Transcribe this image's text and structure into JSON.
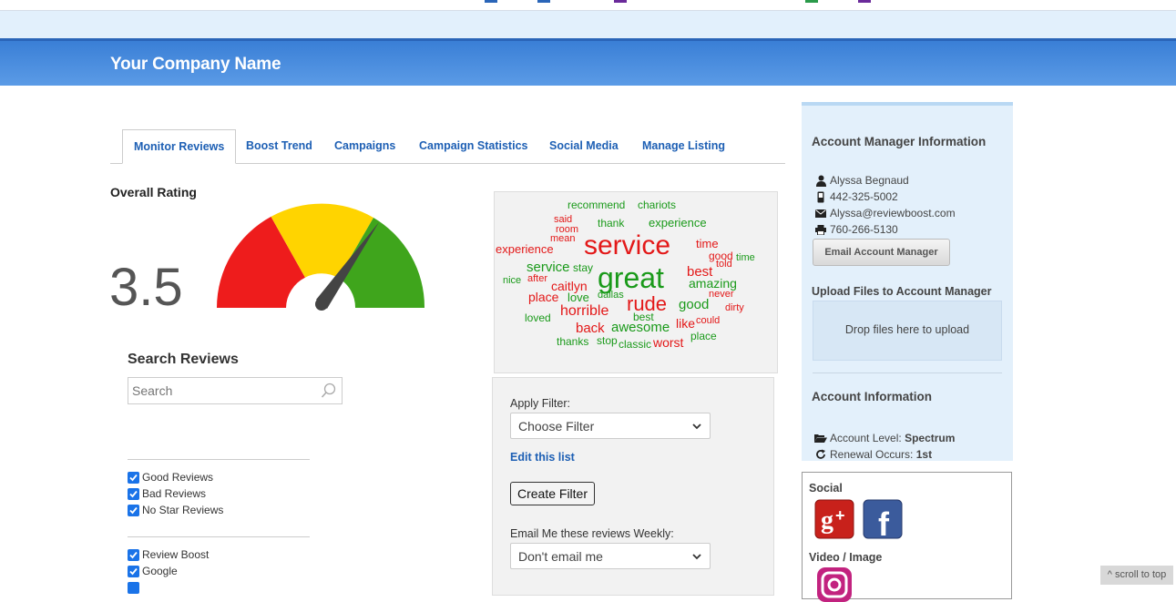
{
  "header": {
    "company_name": "Your Company Name"
  },
  "tabs": [
    {
      "label": "Monitor Reviews",
      "active": true
    },
    {
      "label": "Boost Trend"
    },
    {
      "label": "Campaigns"
    },
    {
      "label": "Campaign Statistics"
    },
    {
      "label": "Social Media"
    },
    {
      "label": "Manage Listing"
    }
  ],
  "rating": {
    "title": "Overall Rating",
    "value": "3.5",
    "gauge_fraction": 0.7,
    "colors": [
      "#ee1c1c",
      "#ffd400",
      "#3fa51c"
    ]
  },
  "search": {
    "title": "Search Reviews",
    "placeholder": "Search"
  },
  "filters_group1": [
    "Good Reviews",
    "Bad Reviews",
    "No Star Reviews"
  ],
  "filters_group2": [
    "Review Boost",
    "Google"
  ],
  "word_cloud": {
    "words": [
      {
        "text": "recommend",
        "color": "green"
      },
      {
        "text": "chariots",
        "color": "green"
      },
      {
        "text": "said",
        "color": "red"
      },
      {
        "text": "thank",
        "color": "green"
      },
      {
        "text": "experience",
        "color": "green"
      },
      {
        "text": "room",
        "color": "red"
      },
      {
        "text": "mean",
        "color": "red"
      },
      {
        "text": "service",
        "color": "red"
      },
      {
        "text": "time",
        "color": "red"
      },
      {
        "text": "experience",
        "color": "red"
      },
      {
        "text": "good",
        "color": "red"
      },
      {
        "text": "time",
        "color": "green"
      },
      {
        "text": "told",
        "color": "red"
      },
      {
        "text": "service",
        "color": "green"
      },
      {
        "text": "stay",
        "color": "green"
      },
      {
        "text": "great",
        "color": "green"
      },
      {
        "text": "best",
        "color": "red"
      },
      {
        "text": "nice",
        "color": "green"
      },
      {
        "text": "after",
        "color": "red"
      },
      {
        "text": "amazing",
        "color": "green"
      },
      {
        "text": "caitlyn",
        "color": "red"
      },
      {
        "text": "place",
        "color": "red"
      },
      {
        "text": "love",
        "color": "green"
      },
      {
        "text": "dallas",
        "color": "green"
      },
      {
        "text": "rude",
        "color": "red"
      },
      {
        "text": "never",
        "color": "red"
      },
      {
        "text": "good",
        "color": "green"
      },
      {
        "text": "horrible",
        "color": "red"
      },
      {
        "text": "dirty",
        "color": "red"
      },
      {
        "text": "loved",
        "color": "green"
      },
      {
        "text": "best",
        "color": "green"
      },
      {
        "text": "back",
        "color": "red"
      },
      {
        "text": "awesome",
        "color": "green"
      },
      {
        "text": "like",
        "color": "red"
      },
      {
        "text": "could",
        "color": "red"
      },
      {
        "text": "place",
        "color": "green"
      },
      {
        "text": "thanks",
        "color": "green"
      },
      {
        "text": "stop",
        "color": "green"
      },
      {
        "text": "classic",
        "color": "green"
      },
      {
        "text": "worst",
        "color": "red"
      }
    ]
  },
  "filter_panel": {
    "apply_label": "Apply Filter:",
    "choose_value": "Choose Filter",
    "edit_link": "Edit this list",
    "create_button": "Create Filter",
    "email_label": "Email Me these reviews Weekly:",
    "email_value": "Don't email me"
  },
  "account_manager": {
    "title": "Account Manager Information",
    "name": "Alyssa Begnaud",
    "phone": "442-325-5002",
    "email": "Alyssa@reviewboost.com",
    "fax": "760-266-5130",
    "email_button": "Email Account Manager",
    "upload_title": "Upload Files to Account Manager",
    "drop_text": "Drop files here to upload"
  },
  "account_info": {
    "title": "Account Information",
    "level_label": "Account Level:",
    "level_value": "Spectrum",
    "renewal_label": "Renewal Occurs:",
    "renewal_value": "1st"
  },
  "social": {
    "title": "Social",
    "video_title": "Video / Image"
  },
  "scroll_to_top": "^ scroll to top"
}
